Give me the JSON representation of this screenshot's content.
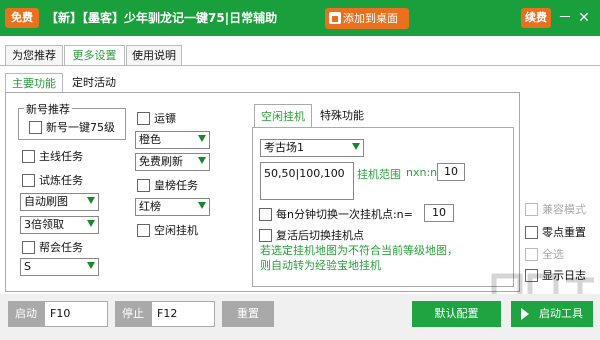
{
  "titlebar": {
    "free_badge": "免费",
    "title": "【新】【墨客】少年驯龙记一键75|日常辅助",
    "add_desktop": "添加到桌面",
    "renew": "续费",
    "min": "－",
    "close": "✕",
    "accent": "#19a03c",
    "orange": "#e8701f"
  },
  "tabs": [
    "为您推荐",
    "更多设置",
    "使用说明"
  ],
  "subtabs": [
    "主要功能",
    "定时活动"
  ],
  "main": {
    "new_group_label": "新号推荐",
    "new_one_click": "新号一键75级",
    "main_quest": "主线任务",
    "trial_quest": "试炼任务",
    "auto_refresh": "自动刷图",
    "triple_claim": "3倍领取",
    "guild_quest": "帮会任务",
    "s_select": "S",
    "escort": "运镖",
    "orange": "橙色",
    "free_refresh": "免费刷新",
    "imperial_quest": "皇榜任务",
    "red_list": "红榜",
    "idle_hang": "空闲挂机"
  },
  "panel": {
    "tabs": [
      "空闲挂机",
      "特殊功能"
    ],
    "map_select": "考古场1",
    "coords": "50,50|100,100",
    "range_label": "挂机范围",
    "nxn_label": "nxn:n=",
    "range_value": "10",
    "switch_label": "每n分钟切换一次挂机点:n=",
    "switch_value": "10",
    "revive_switch": "复活后切换挂机点",
    "note": "若选定挂机地图为不符合当前等级地图，则自动转为经验宝地挂机",
    "note_color": "#2aa03a"
  },
  "right": {
    "compat": "兼容模式",
    "zero_reset": "零点重置",
    "select_all": "全选",
    "show_log": "显示日志"
  },
  "bottom": {
    "start_label": "启动",
    "start_key": "F10",
    "stop_label": "停止",
    "stop_key": "F12",
    "reset": "重置",
    "default_config": "默认配置",
    "start_tool": "启动工具"
  }
}
